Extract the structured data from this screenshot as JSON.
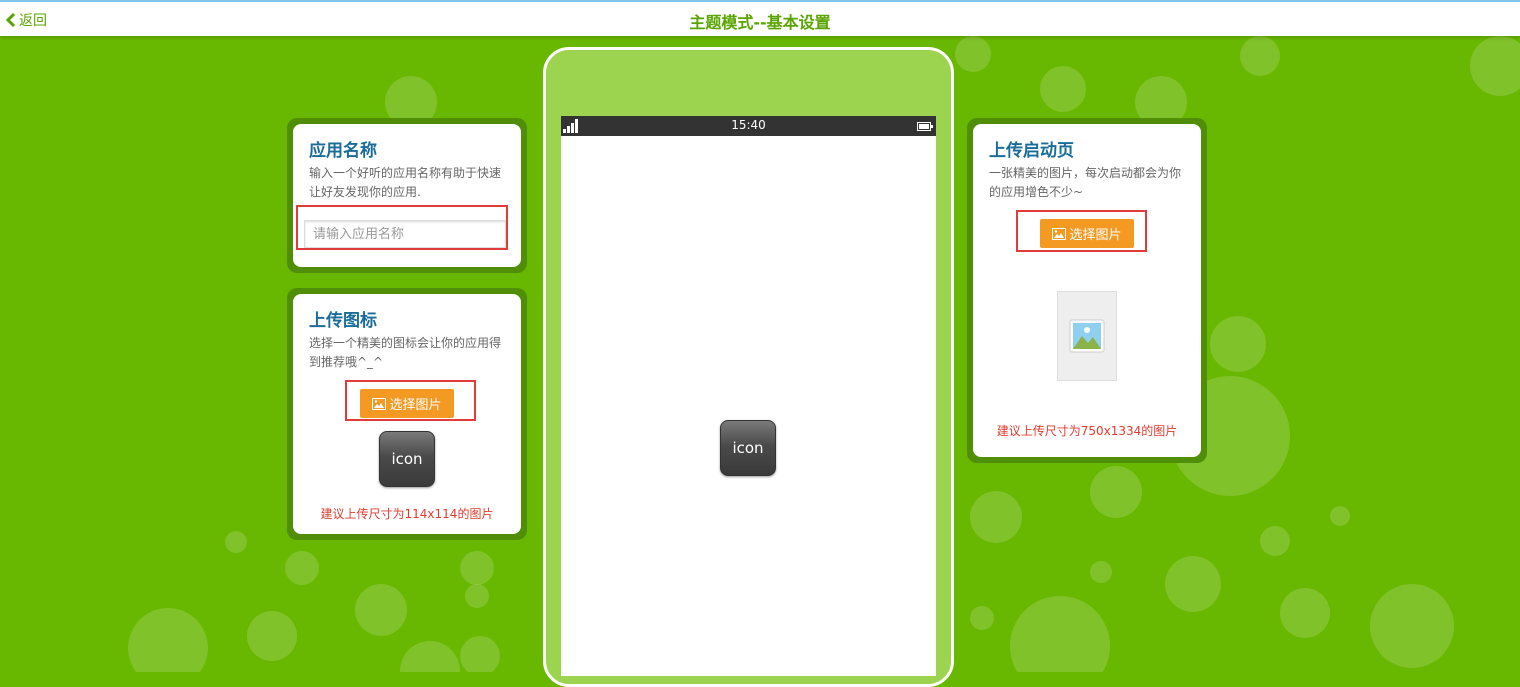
{
  "header": {
    "back_label": "返回",
    "title": "主题模式--基本设置"
  },
  "app_name_card": {
    "title": "应用名称",
    "description": "输入一个好听的应用名称有助于快速让好友发现你的应用.",
    "input_placeholder": "请输入应用名称",
    "input_value": ""
  },
  "icon_card": {
    "title": "上传图标",
    "description": "选择一个精美的图标会让你的应用得到推荐哦^_^",
    "select_button_label": "选择图片",
    "icon_label": "icon",
    "hint": "建议上传尺寸为114x114的图片"
  },
  "phone": {
    "time": "15:40",
    "icon_label": "icon"
  },
  "splash_card": {
    "title": "上传启动页",
    "description": "一张精美的图片，每次启动都会为你的应用增色不少~",
    "select_button_label": "选择图片",
    "hint": "建议上传尺寸为750x1334的图片"
  },
  "colors": {
    "background": "#68b700",
    "accent": "#5aa500",
    "button": "#f49a23",
    "title_blue": "#1b6d99",
    "hint_red": "#e23b2e"
  }
}
